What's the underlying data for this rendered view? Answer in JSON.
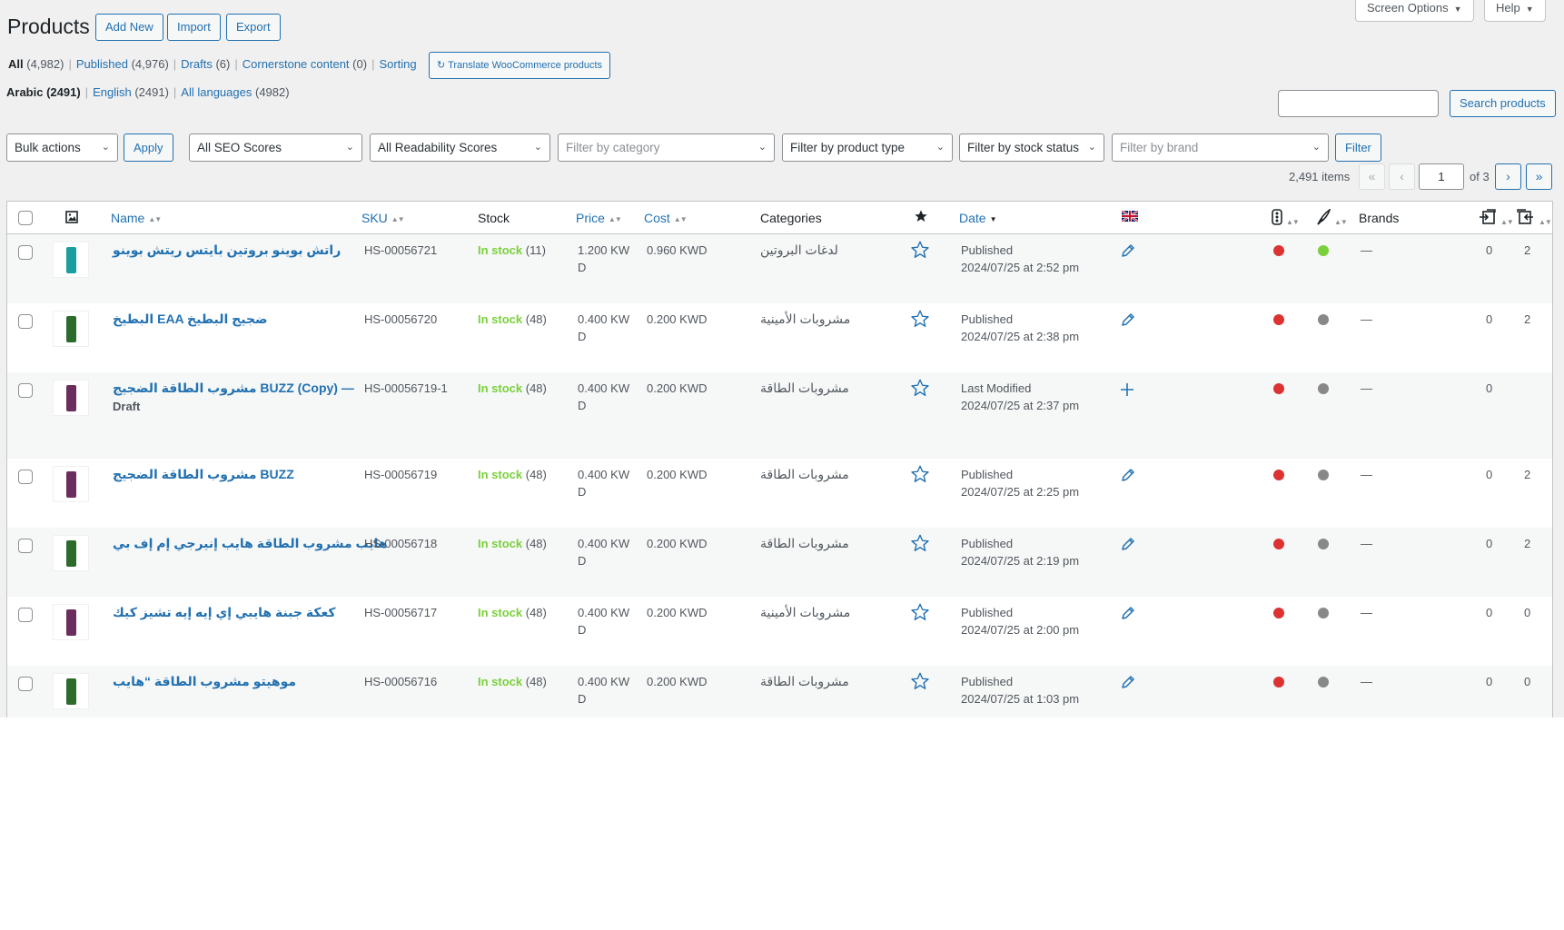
{
  "header": {
    "title": "Products",
    "add_new": "Add New",
    "import": "Import",
    "export": "Export",
    "screen_options": "Screen Options",
    "help": "Help"
  },
  "status_links": [
    {
      "label": "All",
      "count": "(4,982)",
      "current": true
    },
    {
      "label": "Published",
      "count": "(4,976)"
    },
    {
      "label": "Drafts",
      "count": "(6)"
    },
    {
      "label": "Cornerstone content",
      "count": "(0)"
    },
    {
      "label": "Sorting",
      "count": ""
    }
  ],
  "translate_button": "Translate WooCommerce products",
  "language_links": [
    {
      "label": "Arabic",
      "count": "(2491)",
      "current": true
    },
    {
      "label": "English",
      "count": "(2491)"
    },
    {
      "label": "All languages",
      "count": "(4982)"
    }
  ],
  "search": {
    "placeholder": "",
    "button": "Search products"
  },
  "filters": {
    "bulk_actions": "Bulk actions",
    "apply": "Apply",
    "seo": "All SEO Scores",
    "readability": "All Readability Scores",
    "category": "Filter by category",
    "product_type": "Filter by product type",
    "stock_status": "Filter by stock status",
    "brand": "Filter by brand",
    "filter_button": "Filter"
  },
  "pagination": {
    "items": "2,491 items",
    "first": "«",
    "prev": "‹",
    "next": "›",
    "last": "»",
    "current_page": "1",
    "of_pages": "of 3"
  },
  "columns": {
    "name": "Name",
    "sku": "SKU",
    "stock": "Stock",
    "price": "Price",
    "cost": "Cost",
    "categories": "Categories",
    "date": "Date",
    "brands": "Brands"
  },
  "rows": [
    {
      "name": "راتش بوينو بروتين بايتس ريتش بوينو",
      "sku": "HS-00056721",
      "stock_label": "In stock",
      "stock_count": "(11)",
      "price_1": "1.200 KW",
      "price_2": "D",
      "cost": "0.960 KWD",
      "category": "لدغات البروتين",
      "date_status": "Published",
      "date_value": "2024/07/25 at 2:52 pm",
      "lang_action": "edit",
      "seo_color": "#dc3232",
      "read_color": "#7ad03a",
      "brands": "—",
      "links_out": "0",
      "links_in": "2"
    },
    {
      "name": "البطيخ EAA ضجيج البطيخ",
      "sku": "HS-00056720",
      "stock_label": "In stock",
      "stock_count": "(48)",
      "price_1": "0.400 KW",
      "price_2": "D",
      "cost": "0.200 KWD",
      "category": "مشروبات الأمينية",
      "date_status": "Published",
      "date_value": "2024/07/25 at 2:38 pm",
      "lang_action": "edit",
      "seo_color": "#dc3232",
      "read_color": "#888888",
      "brands": "—",
      "links_out": "0",
      "links_in": "2"
    },
    {
      "name": "مشروب الطاقة الضجيج BUZZ (Copy) —",
      "name_2": "Draft",
      "sku": "HS-00056719-1",
      "stock_label": "In stock",
      "stock_count": "(48)",
      "price_1": "0.400 KW",
      "price_2": "D",
      "cost": "0.200 KWD",
      "category": "مشروبات الطاقة",
      "date_status": "Last Modified",
      "date_value": "2024/07/25 at 2:37 pm",
      "lang_action": "add",
      "seo_color": "#dc3232",
      "read_color": "#888888",
      "brands": "—",
      "links_out": "0",
      "links_in": ""
    },
    {
      "name": "مشروب الطاقة الضجيج BUZZ",
      "sku": "HS-00056719",
      "stock_label": "In stock",
      "stock_count": "(48)",
      "price_1": "0.400 KW",
      "price_2": "D",
      "cost": "0.200 KWD",
      "category": "مشروبات الطاقة",
      "date_status": "Published",
      "date_value": "2024/07/25 at 2:25 pm",
      "lang_action": "edit",
      "seo_color": "#dc3232",
      "read_color": "#888888",
      "brands": "—",
      "links_out": "0",
      "links_in": "2"
    },
    {
      "name": "هايب مشروب الطاقة هايب إنيرجي إم إف بي",
      "sku": "HS-00056718",
      "stock_label": "In stock",
      "stock_count": "(48)",
      "price_1": "0.400 KW",
      "price_2": "D",
      "cost": "0.200 KWD",
      "category": "مشروبات الطاقة",
      "date_status": "Published",
      "date_value": "2024/07/25 at 2:19 pm",
      "lang_action": "edit",
      "seo_color": "#dc3232",
      "read_color": "#888888",
      "brands": "—",
      "links_out": "0",
      "links_in": "2"
    },
    {
      "name": "كعكة جبنة هايبي إي إيه إيه تشيز كيك",
      "sku": "HS-00056717",
      "stock_label": "In stock",
      "stock_count": "(48)",
      "price_1": "0.400 KW",
      "price_2": "D",
      "cost": "0.200 KWD",
      "category": "مشروبات الأمينية",
      "date_status": "Published",
      "date_value": "2024/07/25 at 2:00 pm",
      "lang_action": "edit",
      "seo_color": "#dc3232",
      "read_color": "#888888",
      "brands": "—",
      "links_out": "0",
      "links_in": "0"
    },
    {
      "name": "موهيتو مشروب الطاقة “هايب",
      "sku": "HS-00056716",
      "stock_label": "In stock",
      "stock_count": "(48)",
      "price_1": "0.400 KW",
      "price_2": "D",
      "cost": "0.200 KWD",
      "category": "مشروبات الطاقة",
      "date_status": "Published",
      "date_value": "2024/07/25 at 1:03 pm",
      "lang_action": "edit",
      "seo_color": "#dc3232",
      "read_color": "#888888",
      "brands": "—",
      "links_out": "0",
      "links_in": "0"
    }
  ],
  "colors": {
    "link": "#2271b1",
    "in_stock": "#7ad03a",
    "seo_bad": "#dc3232",
    "neutral_dot": "#888888"
  },
  "icons": {
    "featured": "star-icon",
    "lang_flag": "uk-flag-icon",
    "seo": "traffic-light-icon",
    "readability": "quill-icon",
    "internal_links_out": "link-out-icon",
    "internal_links_in": "link-in-icon"
  }
}
